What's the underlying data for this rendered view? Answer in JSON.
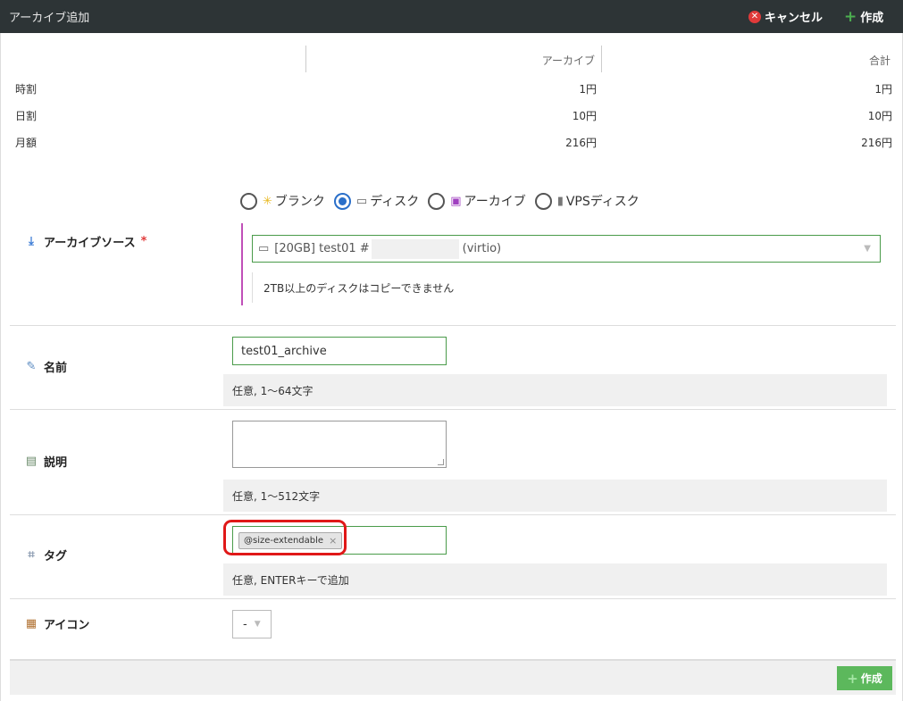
{
  "titlebar": {
    "title": "アーカイブ追加",
    "cancel_label": "キャンセル",
    "create_label": "作成"
  },
  "price_table": {
    "headers": [
      "アーカイブ",
      "合計"
    ],
    "rows": [
      {
        "label": "時割",
        "archive": "1円",
        "total": "1円"
      },
      {
        "label": "日割",
        "archive": "10円",
        "total": "10円"
      },
      {
        "label": "月額",
        "archive": "216円",
        "total": "216円"
      }
    ]
  },
  "archive_source": {
    "label": "アーカイブソース",
    "required_mark": "*",
    "options": [
      {
        "label": "ブランク",
        "icon": "sparkle-icon",
        "selected": false
      },
      {
        "label": "ディスク",
        "icon": "disk-icon",
        "selected": true
      },
      {
        "label": "アーカイブ",
        "icon": "floppy-icon",
        "selected": false
      },
      {
        "label": "VPSディスク",
        "icon": "server-icon",
        "selected": false
      }
    ],
    "selected_value_prefix": "[20GB] test01 #",
    "selected_value_suffix": "(virtio)",
    "help": "2TB以上のディスクはコピーできません"
  },
  "name": {
    "label": "名前",
    "value": "test01_archive",
    "help": "任意, 1～64文字"
  },
  "description": {
    "label": "説明",
    "value": "",
    "help": "任意, 1～512文字"
  },
  "tags": {
    "label": "タグ",
    "items": [
      "@size-extendable"
    ],
    "remove_symbol": "×",
    "help": "任意, ENTERキーで追加"
  },
  "icon_field": {
    "label": "アイコン",
    "value": "-"
  },
  "footer": {
    "create_label": "作成"
  },
  "colors": {
    "titlebar": "#2d3436",
    "accent_green": "#5cb85c",
    "highlight_red": "#e01818",
    "radio_selected": "#2a6fc9"
  }
}
